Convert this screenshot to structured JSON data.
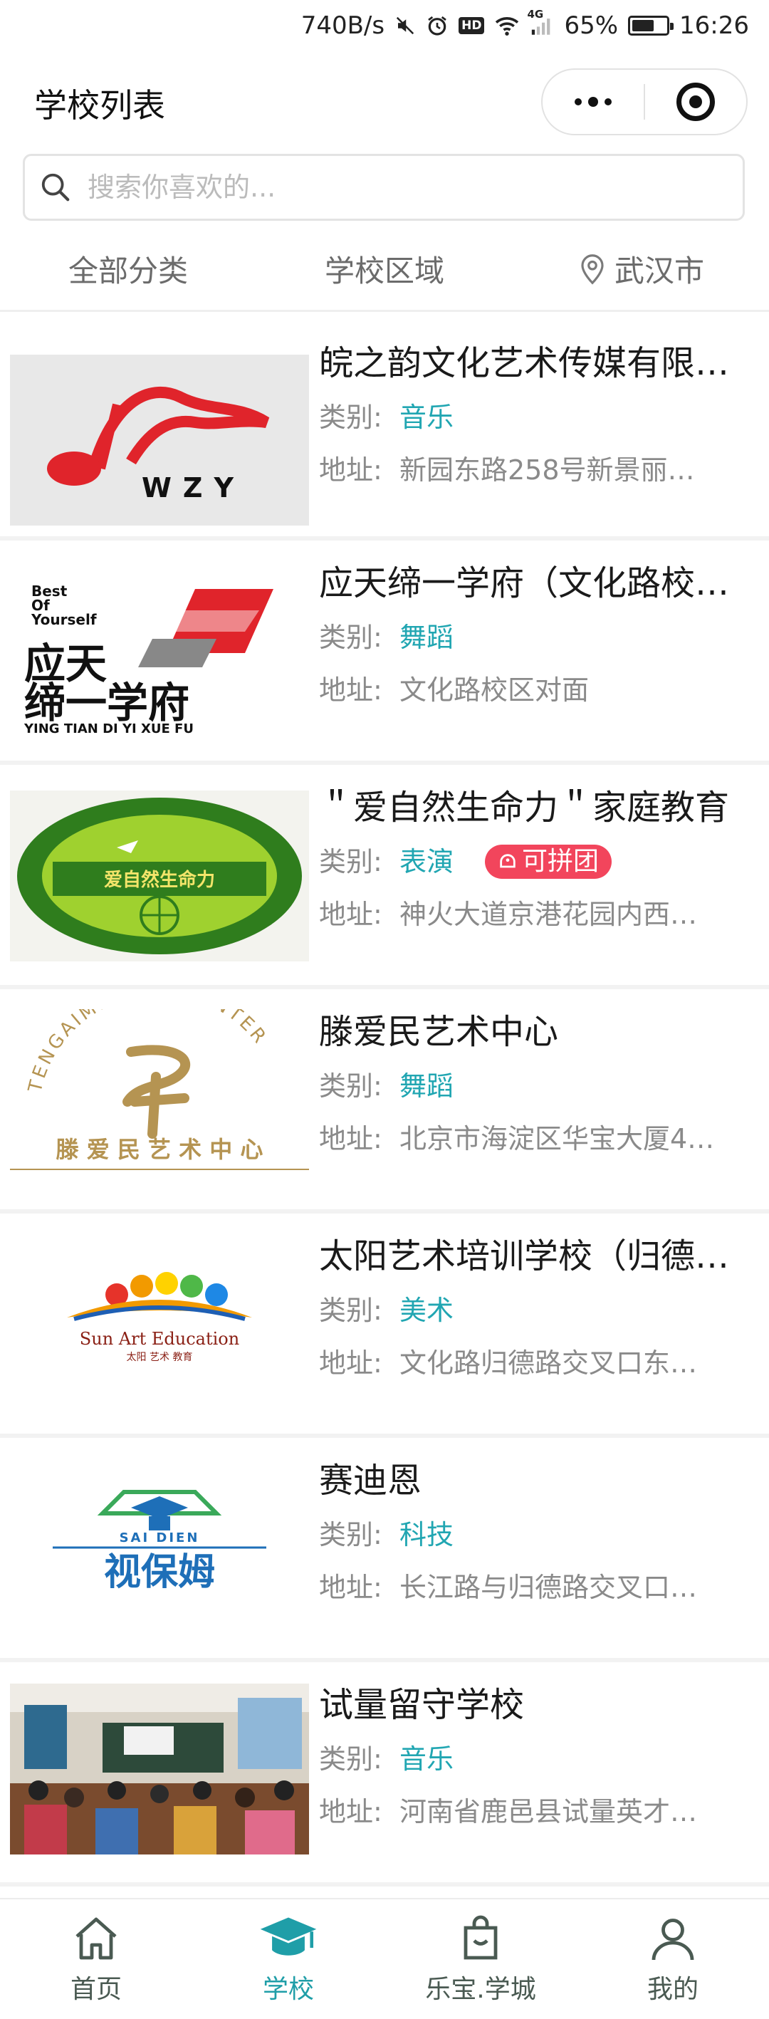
{
  "status_bar": {
    "net_speed": "740B/s",
    "hd_label": "HD",
    "signal_label": "4G",
    "battery_percent": "65%",
    "battery_level": 0.65,
    "time": "16:26"
  },
  "header": {
    "title": "学校列表"
  },
  "search": {
    "placeholder": "搜索你喜欢的..."
  },
  "filters": {
    "category": "全部分类",
    "region": "学校区域",
    "city": "武汉市"
  },
  "labels": {
    "category_prefix": "类别:",
    "address_prefix": "地址:"
  },
  "schools": [
    {
      "name": "皖之韵文化艺术传媒有限公司",
      "category": "音乐",
      "address": "新园东路258号新景丽…",
      "thumb_text": "WZY",
      "badge": ""
    },
    {
      "name": "应天缔一学府（文化路校区）",
      "category": "舞蹈",
      "address": "文化路校区对面",
      "thumb_text": "应天缔一学府",
      "thumb_sub": "YING TIAN DI YI XUE FU",
      "thumb_top": "Best Of Yourself",
      "badge": ""
    },
    {
      "name": "＂爱自然生命力＂家庭教育",
      "category": "表演",
      "address": "神火大道京港花园内西…",
      "thumb_text": "爱自然生命力",
      "badge": "可拼团"
    },
    {
      "name": "滕爱民艺术中心",
      "category": "舞蹈",
      "address": "北京市海淀区华宝大厦4…",
      "thumb_text": "滕 爱 民 艺 术 中 心",
      "thumb_top": "TENGAIMIN ART CENTER",
      "badge": ""
    },
    {
      "name": "太阳艺术培训学校（归德路）",
      "category": "美术",
      "address": "文化路归德路交叉口东…",
      "thumb_text": "Sun Art Education",
      "thumb_sub": "太阳 艺术 教育",
      "badge": ""
    },
    {
      "name": "赛迪恩",
      "category": "科技",
      "address": "长江路与归德路交叉口…",
      "thumb_text": "视保姆",
      "thumb_top": "SAI DIEN",
      "badge": ""
    },
    {
      "name": "试量留守学校",
      "category": "音乐",
      "address": "河南省鹿邑县试量英才…",
      "thumb_text": "",
      "badge": ""
    }
  ],
  "tab_bar": {
    "tabs": [
      {
        "label": "首页",
        "icon": "home-icon"
      },
      {
        "label": "学校",
        "icon": "graduation-cap-icon"
      },
      {
        "label": "乐宝.学城",
        "icon": "shopping-bag-icon"
      },
      {
        "label": "我的",
        "icon": "user-icon"
      }
    ],
    "active_index": 1
  },
  "colors": {
    "accent": "#1f9ea8",
    "category_text": "#21a6b2",
    "badge_bg": "#f2455c"
  }
}
